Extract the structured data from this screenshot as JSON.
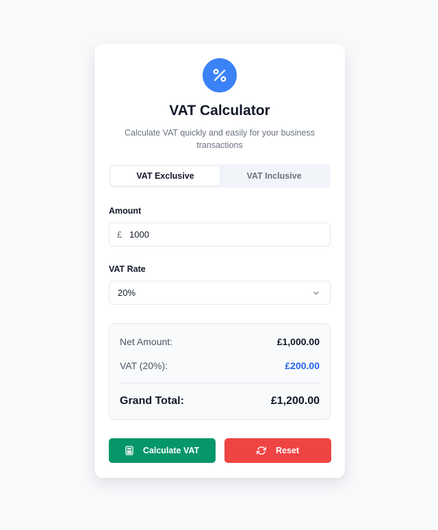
{
  "header": {
    "icon": "percent-icon",
    "title": "VAT Calculator",
    "subtitle": "Calculate VAT quickly and easily for your business transactions"
  },
  "tabs": [
    {
      "label": "VAT Exclusive",
      "active": true
    },
    {
      "label": "VAT Inclusive",
      "active": false
    }
  ],
  "amount": {
    "label": "Amount",
    "currency_symbol": "£",
    "value": "1000"
  },
  "vat_rate": {
    "label": "VAT Rate",
    "selected": "20%"
  },
  "results": {
    "net_label": "Net Amount:",
    "net_value": "£1,000.00",
    "vat_label": "VAT (20%):",
    "vat_value": "£200.00",
    "total_label": "Grand Total:",
    "total_value": "£1,200.00"
  },
  "buttons": {
    "calculate_label": "Calculate VAT",
    "calculate_icon": "calculator-icon",
    "reset_label": "Reset",
    "reset_icon": "refresh-icon"
  },
  "colors": {
    "accent": "#3b82f6",
    "calculate": "#059669",
    "reset": "#ef4444",
    "vat_value": "#2563eb"
  }
}
